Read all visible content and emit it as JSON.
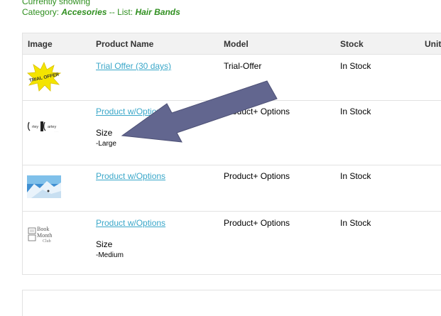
{
  "showing": {
    "line1": "Currently showing",
    "category_label": "Category:",
    "category": "Accesories",
    "separator": "-- List:",
    "list": "Hair Bands"
  },
  "table": {
    "headers": [
      "Image",
      "Product Name",
      "Model",
      "Stock",
      "Unit"
    ],
    "rows": [
      {
        "image": "trial-offer-star-image",
        "image_text": "TRIAL OFFER",
        "name": "Trial Offer (30 days)",
        "model": "Trial-Offer",
        "stock": "In Stock",
        "attr_name": "",
        "attr_value": ""
      },
      {
        "image": "logo-image",
        "image_text": "",
        "name": "Product w/Options",
        "model": "Product+ Options",
        "stock": "In Stock",
        "attr_name": "Size",
        "attr_value": "-Large"
      },
      {
        "image": "snowy-mountain-image",
        "image_text": "",
        "name": "Product w/Options",
        "model": "Product+ Options",
        "stock": "In Stock",
        "attr_name": "",
        "attr_value": ""
      },
      {
        "image": "book-of-month-club-logo",
        "image_text": "Book Month Club",
        "name": "Product w/Options",
        "model": "Product+ Options",
        "stock": "In Stock",
        "attr_name": "Size",
        "attr_value": "-Medium"
      }
    ]
  },
  "colors": {
    "accent_green": "#2f8f1f",
    "link_blue": "#3aa7c9",
    "arrow_fill": "#62668f",
    "header_bg": "#f2f2f2",
    "border": "#e2e2e2"
  }
}
